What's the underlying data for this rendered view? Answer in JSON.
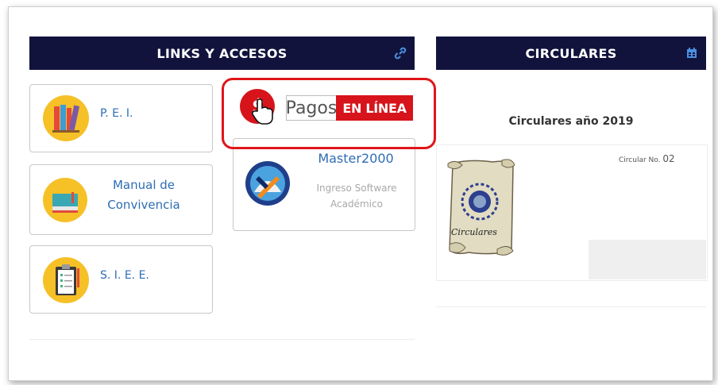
{
  "links": {
    "title": "LINKS Y ACCESOS",
    "title_icon": "link-icon",
    "items": [
      {
        "label": "P. E. I.",
        "icon": "books-icon"
      },
      {
        "label": "Manual de Convivencia",
        "icon": "book-icon"
      },
      {
        "label": "S. I. E. E.",
        "icon": "clipboard-icon"
      }
    ],
    "pagos": {
      "word": "Pagos",
      "badge": "EN LÍNEA",
      "icon": "pointer-hand-icon"
    },
    "master": {
      "title": "Master2000",
      "subtitle": "Ingreso Software Académico",
      "icon": "master2000-logo"
    }
  },
  "circulares": {
    "title": "CIRCULARES",
    "title_icon": "calendar-icon",
    "heading": "Circulares año 2019",
    "item_prefix": "Circular No.",
    "item_number": "02",
    "scroll_text": "Circulares",
    "image_icon": "scroll-icon"
  },
  "colors": {
    "header_bg": "#12133d",
    "link_text": "#2f6db4",
    "icon_bg": "#f6c027",
    "highlight": "#e0151a",
    "pagos_red": "#d7141b"
  }
}
